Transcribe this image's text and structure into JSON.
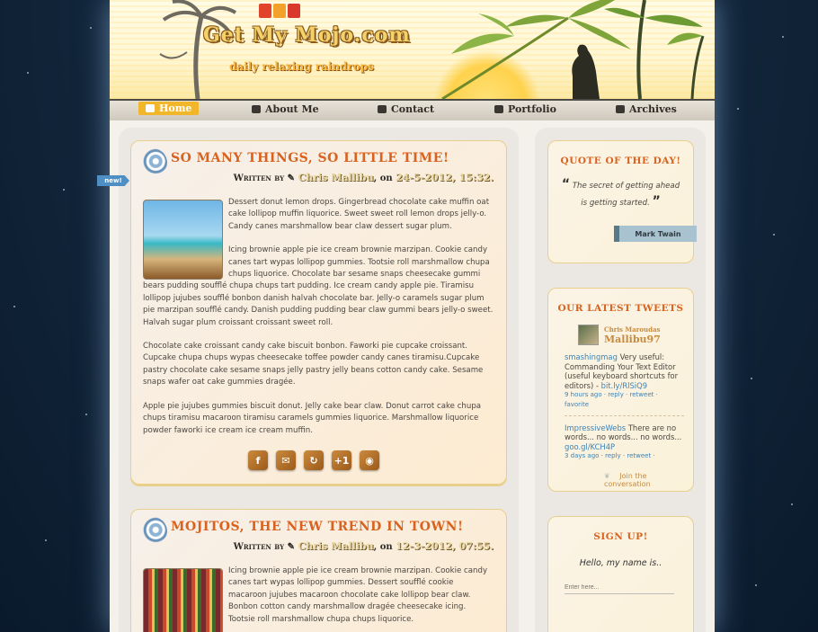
{
  "site": {
    "title": "Get My Mojo.com",
    "tagline": "daily relaxing raindrops"
  },
  "nav": [
    {
      "label": "Home",
      "icon": "home-icon",
      "active": true
    },
    {
      "label": "About Me",
      "icon": "cup-icon"
    },
    {
      "label": "Contact",
      "icon": "speech-icon"
    },
    {
      "label": "Portfolio",
      "icon": "briefcase-icon"
    },
    {
      "label": "Archives",
      "icon": "folder-icon"
    }
  ],
  "posts": [
    {
      "title": "So Many Things, So Little Time!",
      "by_prefix": "Written by",
      "author": "Chris Mallibu",
      "on": ", on",
      "date": "24-5-2012, 15:32.",
      "ribbon": "new!",
      "paragraphs": [
        "Dessert donut lemon drops. Gingerbread chocolate cake muffin oat cake lollipop muffin liquorice. Sweet sweet roll lemon drops jelly-o. Candy canes marshmallow bear claw dessert sugar plum.",
        "Icing brownie apple pie ice cream brownie marzipan. Cookie candy canes tart wypas lollipop gummies. Tootsie roll marshmallow chupa chups liquorice. Chocolate bar sesame snaps cheesecake gummi bears pudding soufflé chupa chups tart pudding. Ice cream candy apple pie. Tiramisu lollipop jujubes soufflé bonbon danish halvah chocolate bar. Jelly-o caramels sugar plum pie marzipan soufflé candy. Danish pudding pudding bear claw gummi bears jelly-o sweet. Halvah sugar plum croissant croissant sweet roll.",
        "Chocolate cake croissant candy cake biscuit bonbon. Faworki pie cupcake croissant. Cupcake chupa chups wypas cheesecake toffee powder candy canes tiramisu.Cupcake pastry chocolate cake sesame snaps jelly pastry jelly beans cotton candy cake. Sesame snaps wafer oat cake gummies dragée.",
        "Apple pie jujubes gummies biscuit donut. Jelly cake bear claw. Donut carrot cake chupa chups tiramisu macaroon tiramisu caramels gummies liquorice. Marshmallow liquorice powder faworki ice cream ice cream muffin."
      ],
      "share": [
        "f",
        "✉",
        "↻",
        "+1",
        "◉"
      ]
    },
    {
      "title": "Mojitos, the New Trend in Town!",
      "by_prefix": "Written by",
      "author": "Chris Mallibu",
      "on": ", on",
      "date": "12-3-2012, 07:55.",
      "paragraphs": [
        "Icing brownie apple pie ice cream brownie marzipan. Cookie candy canes tart wypas lollipop gummies. Dessert soufflé cookie macaroon jujubes macaroon chocolate cake lollipop bear claw. Bonbon cotton candy marshmallow dragée cheesecake icing. Tootsie roll marshmallow chupa chups liquorice."
      ]
    }
  ],
  "sidebar": {
    "quote": {
      "title": "Quote of the Day!",
      "text": "The secret of getting ahead is getting started.",
      "author": "Mark Twain"
    },
    "tweets": {
      "title": "Our Latest Tweets",
      "name": "Chris Maroudas",
      "handle": "Mallibu97",
      "items": [
        {
          "user": "smashingmag",
          "text": "Very useful: Commanding Your Text Editor (useful keyboard shortcuts for editors) - ",
          "link": "bit.ly/RlSiQ9",
          "meta": "9 hours ago · reply · retweet · favorite"
        },
        {
          "user": "ImpressiveWebs",
          "text": "There are no words... no words... no words... ",
          "link": "goo.gl/KCH4P",
          "meta": "3 days ago · reply · retweet ·"
        }
      ],
      "join": "Join the conversation"
    },
    "signup": {
      "title": "Sign Up!",
      "label": "Hello, my name is..",
      "placeholder": "Enter here..."
    }
  }
}
